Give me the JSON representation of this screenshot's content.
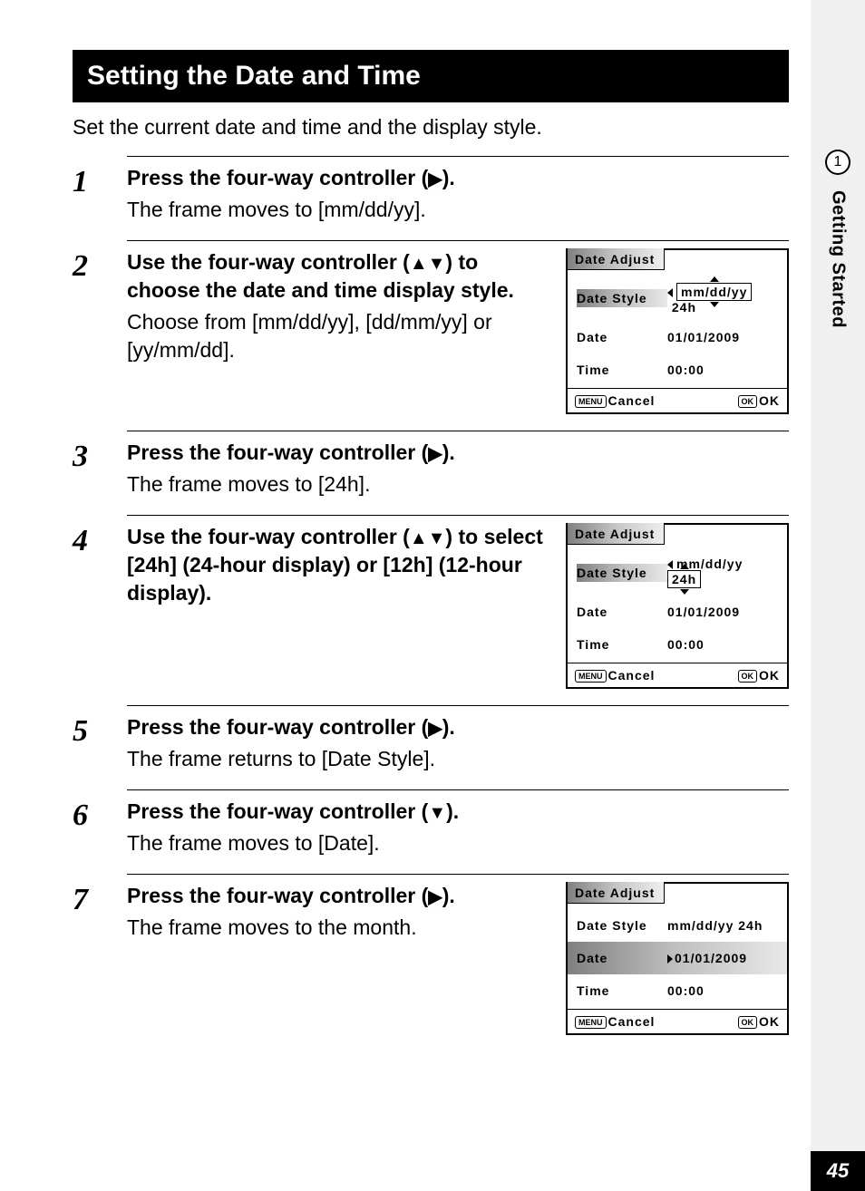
{
  "sidebar": {
    "chapter_number": "1",
    "chapter_title": "Getting Started",
    "page_number": "45"
  },
  "heading": "Setting the Date and Time",
  "intro": "Set the current date and time and the display style.",
  "steps": [
    {
      "num": "1",
      "title_pre": "Press the four-way controller (",
      "title_arrow": "▶",
      "title_post": ").",
      "desc": "The frame moves to [mm/dd/yy]."
    },
    {
      "num": "2",
      "title_pre": "Use the four-way controller (",
      "title_arrow": "▲▼",
      "title_post": ") to choose the date and time display style.",
      "desc": "Choose from [mm/dd/yy], [dd/mm/yy] or [yy/mm/dd]."
    },
    {
      "num": "3",
      "title_pre": "Press the four-way controller (",
      "title_arrow": "▶",
      "title_post": ").",
      "desc": "The frame moves to [24h]."
    },
    {
      "num": "4",
      "title_pre": "Use the four-way controller (",
      "title_arrow": "▲▼",
      "title_post": ") to select [24h] (24-hour display) or [12h] (12-hour display).",
      "desc": ""
    },
    {
      "num": "5",
      "title_pre": "Press the four-way controller (",
      "title_arrow": "▶",
      "title_post": ").",
      "desc": "The frame returns to [Date Style]."
    },
    {
      "num": "6",
      "title_pre": "Press the four-way controller (",
      "title_arrow": "▼",
      "title_post": ").",
      "desc": "The frame moves to [Date]."
    },
    {
      "num": "7",
      "title_pre": "Press the four-way controller (",
      "title_arrow": "▶",
      "title_post": ").",
      "desc": "The frame moves to the month."
    }
  ],
  "lcd": {
    "title": "Date Adjust",
    "labels": {
      "style": "Date Style",
      "date": "Date",
      "time": "Time"
    },
    "values": {
      "style_fmt": "mm/dd/yy",
      "style_hr": "24h",
      "date": "01/01/2009",
      "time": "00:00"
    },
    "footer": {
      "menu_tag": "MENU",
      "cancel": "Cancel",
      "ok_tag": "OK",
      "ok": "OK"
    }
  }
}
